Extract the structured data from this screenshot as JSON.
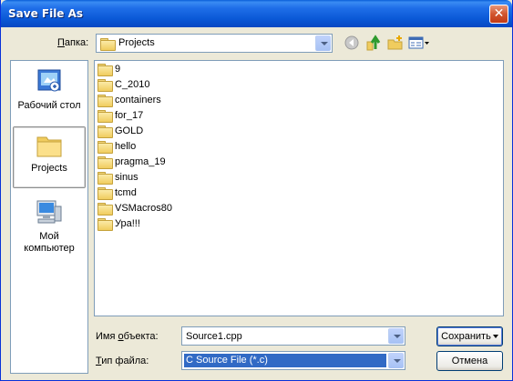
{
  "window": {
    "title": "Save File As",
    "close_glyph": "✕"
  },
  "toolbar": {
    "look_in_label_pre": "",
    "look_in_label_ul": "П",
    "look_in_label_post": "апка:",
    "look_in_value": "Projects",
    "icons": [
      "back-icon",
      "up-folder-icon",
      "new-folder-icon",
      "view-menu-icon"
    ]
  },
  "places": [
    {
      "id": "desktop",
      "label": "Рабочий стол",
      "icon": "desktop-icon"
    },
    {
      "id": "projects",
      "label": "Projects",
      "icon": "folder-icon",
      "selected": true
    },
    {
      "id": "my-computer",
      "label": "Мой компьютер",
      "icon": "computer-icon"
    }
  ],
  "files": [
    "9",
    "C_2010",
    "containers",
    "for_17",
    "GOLD",
    "hello",
    "pragma_19",
    "sinus",
    "tcmd",
    "VSMacros80",
    "Ура!!!"
  ],
  "bottom": {
    "filename_label_pre": "Имя ",
    "filename_label_ul": "о",
    "filename_label_post": "бъекта:",
    "filename_value": "Source1.cpp",
    "filetype_label_pre": "",
    "filetype_label_ul": "Т",
    "filetype_label_post": "ип файла:",
    "filetype_value": "C Source File (*.c)",
    "save_label": "Сохранить",
    "cancel_label": "Отмена"
  },
  "colors": {
    "titlebar": "#0a58d6",
    "selection": "#316ac5",
    "close": "#d2562f"
  }
}
